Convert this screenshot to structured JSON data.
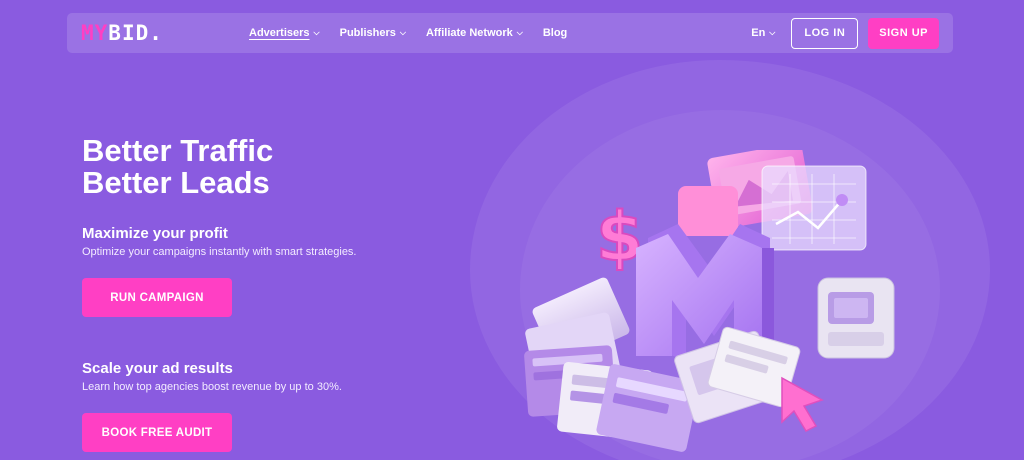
{
  "nav": {
    "logo_part1": "MY",
    "logo_part2": "BID.",
    "items": [
      {
        "label": "Advertisers",
        "has_dropdown": true,
        "active": true
      },
      {
        "label": "Publishers",
        "has_dropdown": true
      },
      {
        "label": "Affiliate Network",
        "has_dropdown": true
      },
      {
        "label": "Blog",
        "has_dropdown": false
      }
    ],
    "language": "En",
    "login_label": "LOG IN",
    "signup_label": "SIGN UP"
  },
  "hero": {
    "headline_line1": "Better Traffic",
    "headline_line2": "Better Leads",
    "block1_title": "Maximize your profit",
    "block1_text": "Optimize your campaigns instantly with smart strategies.",
    "block1_cta": "RUN CAMPAIGN",
    "block2_title": "Scale your ad results",
    "block2_text": "Learn how top agencies boost revenue by up to 30%.",
    "block2_cta": "BOOK FREE AUDIT"
  },
  "illustration": {
    "letter": "M",
    "symbol": "$",
    "icons": [
      "dollar-sign-icon",
      "line-chart-icon",
      "cursor-arrow-icon",
      "monitor-icon"
    ]
  },
  "colors": {
    "background": "#8a5be0",
    "accent": "#ff3fc4",
    "text": "#ffffff"
  }
}
